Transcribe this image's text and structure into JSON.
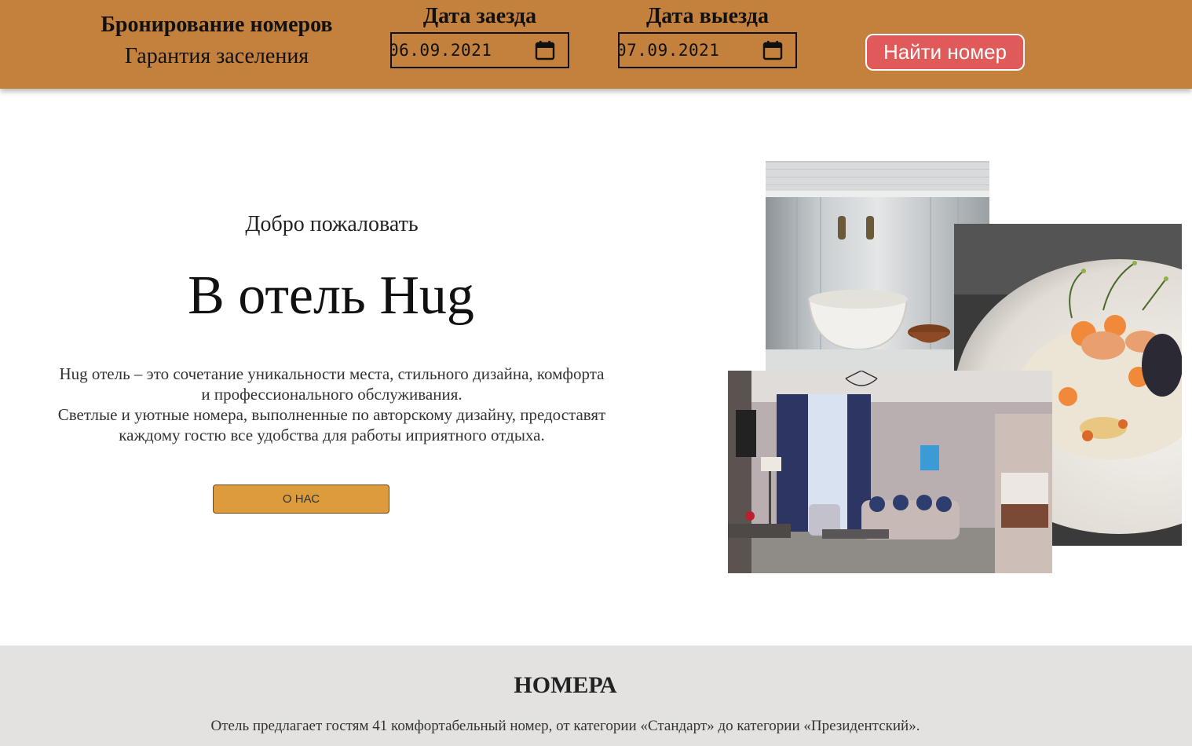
{
  "header": {
    "brand_title": "Бронирование номеров",
    "brand_subtitle": "Гарантия заселения",
    "checkin_label": "Дата заезда",
    "checkin_value": "06.09.2021",
    "checkout_label": "Дата выезда",
    "checkout_value": "07.09.2021",
    "find_button": "Найти номер",
    "calendar_icon": "calendar-icon",
    "colors": {
      "bar": "#c4813d",
      "button": "#e05a5a"
    }
  },
  "hero": {
    "welcome": "Добро пожаловать",
    "title": "В отель Hug",
    "desc_line1": "Hug отель – это сочетание уникальности места, стильного дизайна, комфорта",
    "desc_line2": "и профессионального обслуживания.",
    "desc_line3": "Светлые и уютные номера, выполненные по авторскому дизайну, предоставят",
    "desc_line4": "каждому гостю все удобства для работы иприятного отдыха.",
    "about_button": "О НАС",
    "colors": {
      "button": "#dc9c3b"
    }
  },
  "rooms": {
    "title": "НОМЕРА",
    "text": "Отель предлагает гостям 41 комфортабельный номер, от категории «Стандарт» до категории «Президентский».",
    "colors": {
      "background": "#e3e2e0"
    }
  }
}
